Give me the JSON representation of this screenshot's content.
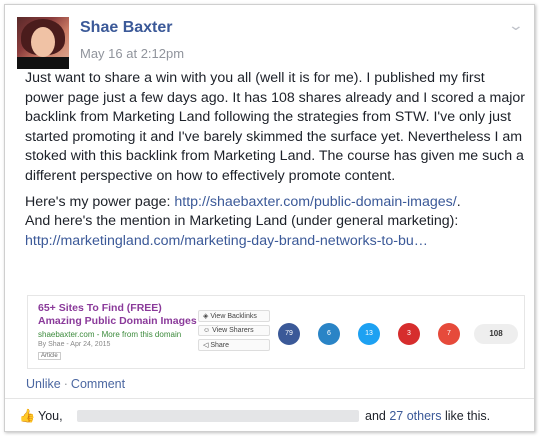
{
  "post": {
    "author": "Shae Baxter",
    "timestamp": "May 16 at 2:12pm",
    "paragraph1": "Just want to share a win with you all (well it is for me). I published my first power page just a few days ago. It has 108 shares already and I scored a major backlink from Marketing Land following the strategies from STW. I've only just started promoting it and I've barely skimmed the surface yet. Nevertheless I am stoked with this backlink from Marketing Land. The course has given me such a different perspective on how to effectively promote content.",
    "line2_prefix": "Here's my power page: ",
    "link1": "http://shaebaxter.com/public-domain-images/",
    "line2_suffix": ".",
    "line3": "And here's the mention in Marketing Land (under general marketing):",
    "link2": "http://marketingland.com/marketing-day-brand-networks-to-bu…"
  },
  "preview": {
    "title": "65+ Sites To Find (FREE) Amazing Public Domain Images",
    "domain": "shaebaxter.com - More from this domain",
    "meta": "By Shae - Apr 24, 2015",
    "tag": "Article",
    "actions": [
      "View Backlinks",
      "View Sharers",
      "Share"
    ],
    "share_counts": [
      {
        "value": "79",
        "color": "#3b5998"
      },
      {
        "value": "6",
        "color": "#2a84c6"
      },
      {
        "value": "13",
        "color": "#1da1f2"
      },
      {
        "value": "3",
        "color": "#d62d2d"
      },
      {
        "value": "7",
        "color": "#e64a3b"
      }
    ],
    "total": "108"
  },
  "actions": {
    "unlike": "Unlike",
    "sep": "·",
    "comment": "Comment"
  },
  "likes": {
    "you": "You,",
    "and": "and ",
    "others_link": "27 others",
    "suffix": " like this."
  }
}
